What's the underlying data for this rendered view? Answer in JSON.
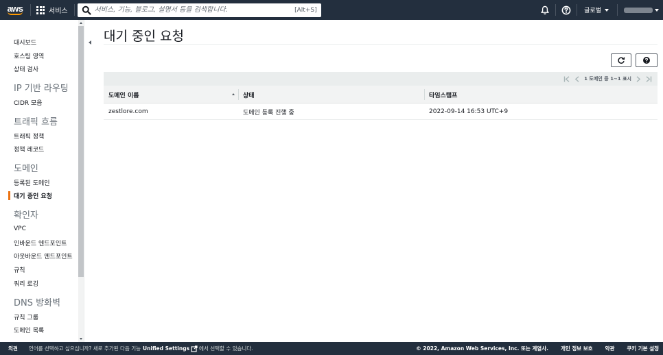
{
  "topnav": {
    "logo": "aws",
    "services_label": "서비스",
    "search_placeholder": "서비스, 기능, 블로그, 설명서 등을 검색합니다.",
    "search_shortcut": "[Alt+S]",
    "region_label": "글로벌",
    "icons": [
      "grid-icon",
      "search-icon",
      "bell-icon",
      "help-icon"
    ]
  },
  "sidebar": {
    "items": [
      {
        "label": "대시보드"
      },
      {
        "label": "호스팅 영역"
      },
      {
        "label": "상태 검사"
      }
    ],
    "sections": [
      {
        "title": "IP 기반 라우팅",
        "items": [
          "CIDR 모음"
        ]
      },
      {
        "title": "트래픽 흐름",
        "items": [
          "트래픽 정책",
          "정책 레코드"
        ]
      },
      {
        "title": "도메인",
        "items": [
          "등록된 도메인",
          "대기 중인 요청"
        ]
      },
      {
        "title": "확인자",
        "items": [
          "VPC",
          "인바운드 엔드포인트",
          "아웃바운드 엔드포인트",
          "규칙",
          "쿼리 로깅"
        ]
      },
      {
        "title": "DNS 방화벽",
        "items": [
          "규칙 그룹",
          "도메인 목록"
        ]
      }
    ],
    "active_item": "대기 중인 요청"
  },
  "main": {
    "title": "대기 중인 요청",
    "pagination": "1 도메인 중 1~1 표시",
    "columns": [
      "도메인 이름",
      "상태",
      "타임스탬프"
    ],
    "rows": [
      {
        "domain": "zestlore.com",
        "status": "도메인 등록 진행 중",
        "timestamp": "2022-09-14 16:53 UTC+9"
      }
    ]
  },
  "footer": {
    "feedback": "의견",
    "lang_prefix": "언어를 선택하고 싶으십니까? 새로 추가된 다음 기능",
    "unified_settings": "Unified Settings",
    "lang_suffix": "에서 선택할 수 있습니다.",
    "copyright": "© 2022, Amazon Web Services, Inc. 또는 계열사.",
    "privacy": "개인 정보 보호",
    "terms": "약관",
    "cookies": "쿠키 기본 설정"
  },
  "colors": {
    "nav_bg": "#232f3e",
    "accent": "#ec7211",
    "logo_smile": "#ff9900"
  }
}
